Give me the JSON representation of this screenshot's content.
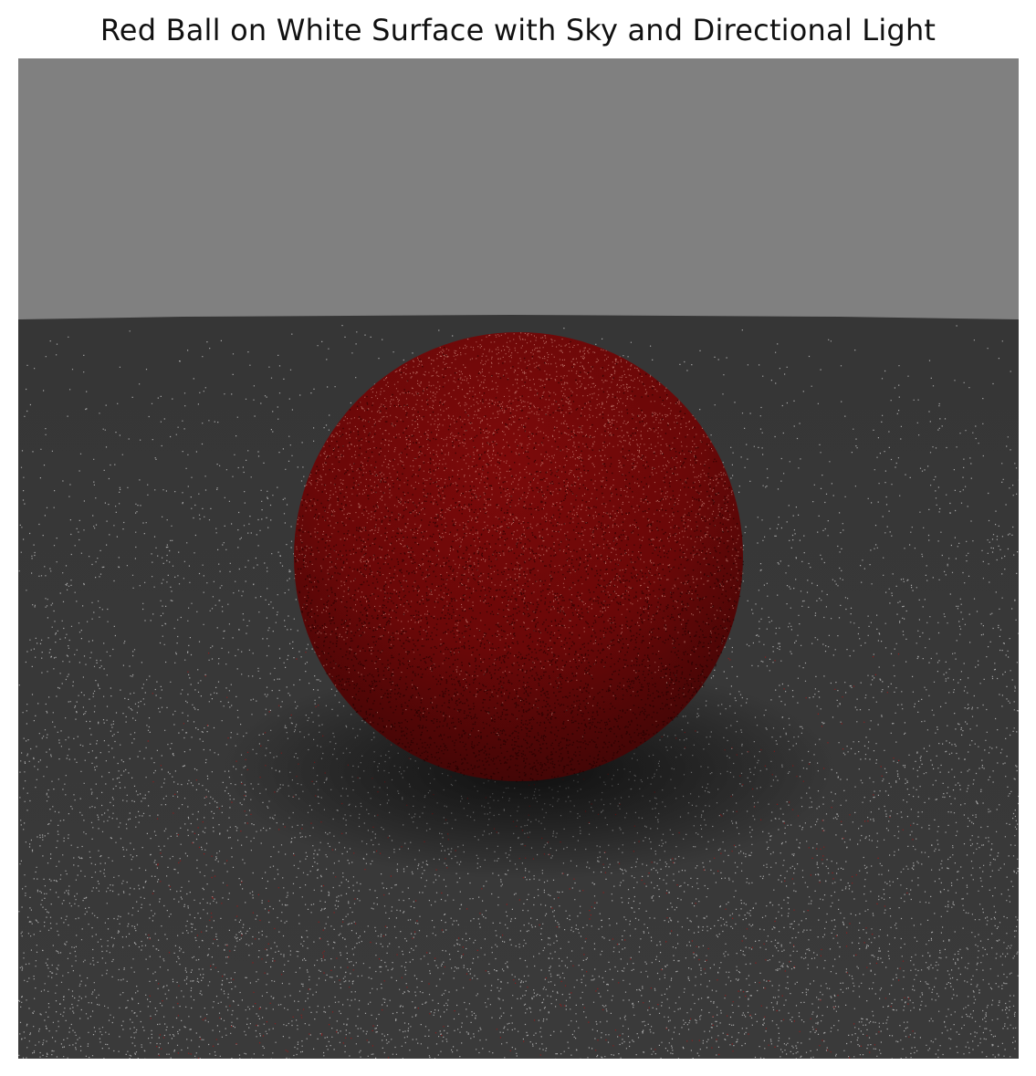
{
  "figure": {
    "title": "Red Ball on White Surface with Sky and Directional Light"
  },
  "scene": {
    "sky_color": "#808080",
    "ground_color": "#373737",
    "ball_color": "#8a0b0b",
    "noise_color": "#ffffff"
  }
}
